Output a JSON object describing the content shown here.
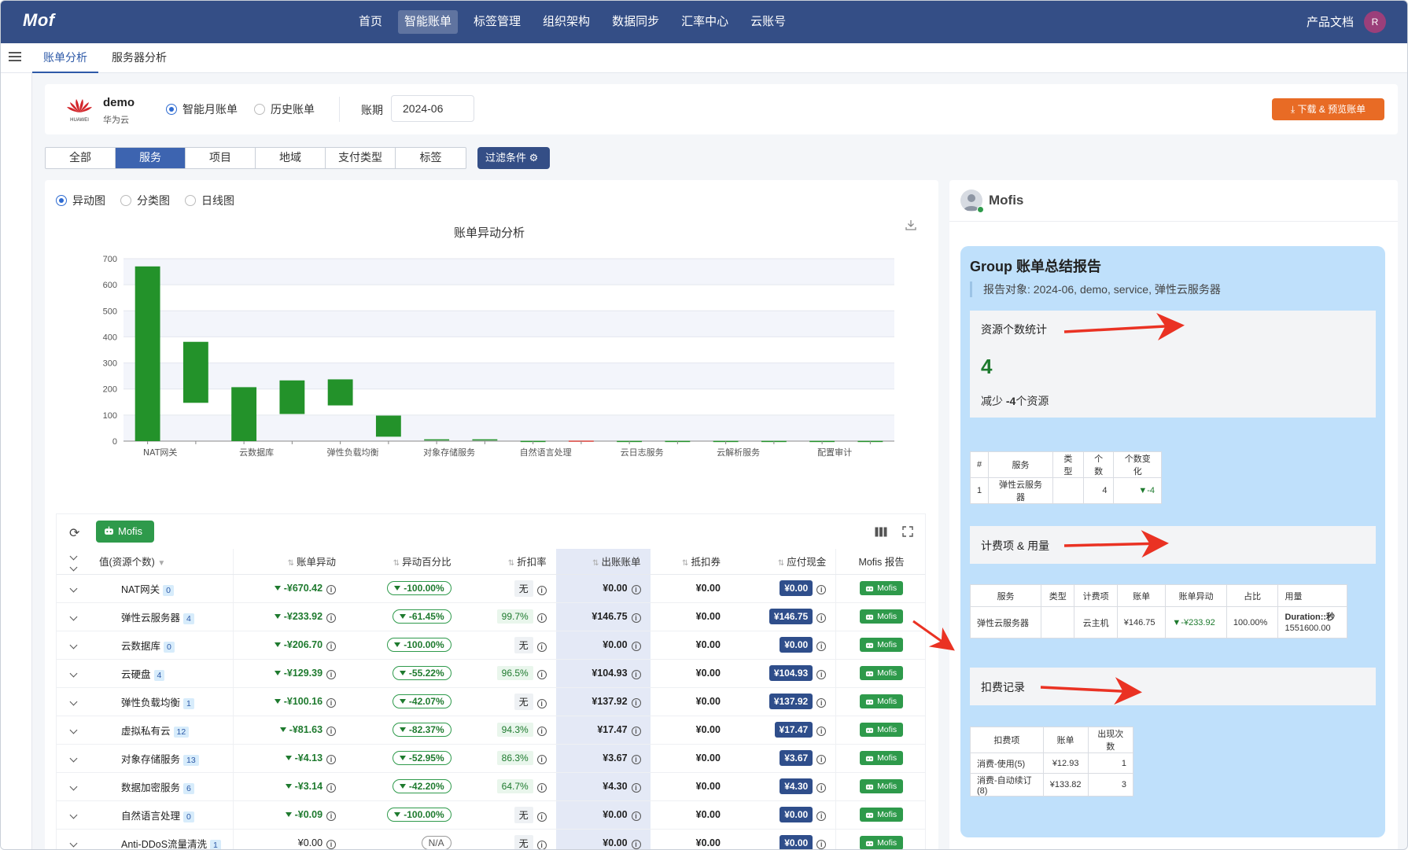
{
  "app": {
    "logo": "Mof",
    "docs": "产品文档",
    "avatar": "R"
  },
  "nav": [
    {
      "label": "首页",
      "active": false
    },
    {
      "label": "智能账单",
      "active": true
    },
    {
      "label": "标签管理",
      "active": false
    },
    {
      "label": "组织架构",
      "active": false
    },
    {
      "label": "数据同步",
      "active": false
    },
    {
      "label": "汇率中心",
      "active": false
    },
    {
      "label": "云账号",
      "active": false
    }
  ],
  "subtabs": [
    {
      "label": "账单分析",
      "active": true
    },
    {
      "label": "服务器分析",
      "active": false
    }
  ],
  "account": {
    "name": "demo",
    "provider": "华为云",
    "logo_text": "HUAWEI",
    "bill_modes": [
      {
        "label": "智能月账单",
        "selected": true
      },
      {
        "label": "历史账单",
        "selected": false
      }
    ],
    "period_label": "账期",
    "period_value": "2024-06",
    "download_label": "下载 & 预览账单"
  },
  "group_tabs": [
    {
      "label": "全部",
      "active": false
    },
    {
      "label": "服务",
      "active": true
    },
    {
      "label": "项目",
      "active": false
    },
    {
      "label": "地域",
      "active": false
    },
    {
      "label": "支付类型",
      "active": false
    },
    {
      "label": "标签",
      "active": false
    }
  ],
  "filter_label": "过滤条件",
  "chart_modes": [
    {
      "label": "异动图",
      "selected": true
    },
    {
      "label": "分类图",
      "selected": false
    },
    {
      "label": "日线图",
      "selected": false
    }
  ],
  "chart_data": {
    "type": "bar",
    "subtype": "waterfall",
    "title": "账单异动分析",
    "ylim": [
      0,
      700
    ],
    "yticks": [
      0,
      100,
      200,
      300,
      400,
      500,
      600,
      700
    ],
    "grid": true,
    "x_tick_labels": [
      "NAT网关",
      "云数据库",
      "弹性负载均衡",
      "对象存储服务",
      "自然语言处理",
      "云日志服务",
      "云解析服务",
      "配置审计"
    ],
    "bars": [
      {
        "low": 0,
        "high": 670.42,
        "color": "#23922a"
      },
      {
        "low": 147,
        "high": 381,
        "color": "#23922a"
      },
      {
        "low": 0,
        "high": 207,
        "color": "#23922a"
      },
      {
        "low": 104,
        "high": 233,
        "color": "#23922a"
      },
      {
        "low": 137,
        "high": 237,
        "color": "#23922a"
      },
      {
        "low": 17,
        "high": 98,
        "color": "#23922a"
      },
      {
        "low": 3,
        "high": 7,
        "color": "#23922a"
      },
      {
        "low": 4,
        "high": 7,
        "color": "#23922a"
      },
      {
        "low": 0,
        "high": 1,
        "color": "#23922a"
      },
      {
        "low": 0,
        "high": 2,
        "color": "#d9443c"
      },
      {
        "low": 0,
        "high": 1,
        "color": "#23922a"
      },
      {
        "low": 0,
        "high": 1,
        "color": "#23922a"
      },
      {
        "low": 0,
        "high": 1,
        "color": "#23922a"
      },
      {
        "low": 0,
        "high": 1,
        "color": "#23922a"
      },
      {
        "low": 0,
        "high": 1,
        "color": "#23922a"
      },
      {
        "low": 0,
        "high": 1,
        "color": "#23922a"
      }
    ]
  },
  "table": {
    "mofis_label": "Mofis",
    "columns": [
      "值(资源个数)",
      "账单异动",
      "异动百分比",
      "折扣率",
      "出账账单",
      "抵扣券",
      "应付现金",
      "Mofis 报告"
    ],
    "rows": [
      {
        "name": "NAT网关",
        "count": "0",
        "change": "-¥670.42",
        "pct": "-100.00%",
        "discount": "无",
        "bill": "¥0.00",
        "coupon": "¥0.00",
        "cash": "¥0.00"
      },
      {
        "name": "弹性云服务器",
        "count": "4",
        "change": "-¥233.92",
        "pct": "-61.45%",
        "discount": "99.7%",
        "bill": "¥146.75",
        "coupon": "¥0.00",
        "cash": "¥146.75"
      },
      {
        "name": "云数据库",
        "count": "0",
        "change": "-¥206.70",
        "pct": "-100.00%",
        "discount": "无",
        "bill": "¥0.00",
        "coupon": "¥0.00",
        "cash": "¥0.00"
      },
      {
        "name": "云硬盘",
        "count": "4",
        "change": "-¥129.39",
        "pct": "-55.22%",
        "discount": "96.5%",
        "bill": "¥104.93",
        "coupon": "¥0.00",
        "cash": "¥104.93"
      },
      {
        "name": "弹性负载均衡",
        "count": "1",
        "change": "-¥100.16",
        "pct": "-42.07%",
        "discount": "无",
        "bill": "¥137.92",
        "coupon": "¥0.00",
        "cash": "¥137.92"
      },
      {
        "name": "虚拟私有云",
        "count": "12",
        "change": "-¥81.63",
        "pct": "-82.37%",
        "discount": "94.3%",
        "bill": "¥17.47",
        "coupon": "¥0.00",
        "cash": "¥17.47"
      },
      {
        "name": "对象存储服务",
        "count": "13",
        "change": "-¥4.13",
        "pct": "-52.95%",
        "discount": "86.3%",
        "bill": "¥3.67",
        "coupon": "¥0.00",
        "cash": "¥3.67"
      },
      {
        "name": "数据加密服务",
        "count": "6",
        "change": "-¥3.14",
        "pct": "-42.20%",
        "discount": "64.7%",
        "bill": "¥4.30",
        "coupon": "¥0.00",
        "cash": "¥4.30"
      },
      {
        "name": "自然语言处理",
        "count": "0",
        "change": "-¥0.09",
        "pct": "-100.00%",
        "discount": "无",
        "bill": "¥0.00",
        "coupon": "¥0.00",
        "cash": "¥0.00"
      },
      {
        "name": "Anti-DDoS流量清洗",
        "count": "1",
        "change": "¥0.00",
        "pct": "N/A",
        "discount": "无",
        "bill": "¥0.00",
        "coupon": "¥0.00",
        "cash": "¥0.00"
      }
    ]
  },
  "right": {
    "title": "Mofis",
    "report_title": "Group 账单总结报告",
    "report_target_label": "报告对象:",
    "report_target_value": "2024-06, demo, service, 弹性云服务器",
    "resource_section": "资源个数统计",
    "resource_count": "4",
    "reduce_prefix": "减少",
    "reduce_value": "-4",
    "reduce_suffix": "个资源",
    "resource_table": {
      "headers": [
        "#",
        "服务",
        "类型",
        "个数",
        "个数变化"
      ],
      "rows": [
        [
          "1",
          "弹性云服务器",
          "",
          "4",
          "▼-4"
        ]
      ]
    },
    "billing_section": "计费项 & 用量",
    "billing_table": {
      "headers": [
        "服务",
        "类型",
        "计费项",
        "账单",
        "账单异动",
        "占比",
        "用量"
      ],
      "rows": [
        [
          "弹性云服务器",
          "",
          "云主机",
          "¥146.75",
          "▼-¥233.92",
          "100.00%",
          "Duration::秒",
          "1551600.00"
        ]
      ]
    },
    "deduct_section": "扣费记录",
    "deduct_table": {
      "headers": [
        "扣费项",
        "账单",
        "出现次数"
      ],
      "rows": [
        [
          "消费-使用(5)",
          "¥12.93",
          "1"
        ],
        [
          "消费-自动续订(8)",
          "¥133.82",
          "3"
        ]
      ]
    }
  },
  "colors": {
    "nav_bg": "#344e86",
    "green": "#23922a",
    "accent_blue": "#2f4e8b",
    "orange": "#e86b25",
    "report_bg": "#bfe0fb"
  }
}
